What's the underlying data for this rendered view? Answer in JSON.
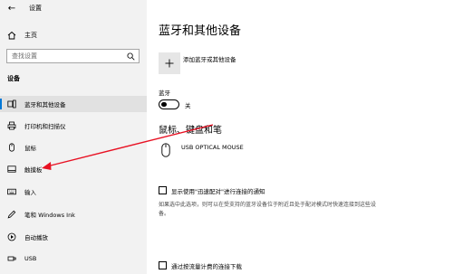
{
  "window": {
    "title": "设置"
  },
  "sidebar": {
    "home_label": "主页",
    "search_placeholder": "查找设置",
    "section_title": "设备",
    "items": [
      {
        "label": "蓝牙和其他设备",
        "icon": "bluetooth-devices-icon",
        "active": true
      },
      {
        "label": "打印机和扫描仪",
        "icon": "printer-icon",
        "active": false
      },
      {
        "label": "鼠标",
        "icon": "mouse-icon",
        "active": false
      },
      {
        "label": "触摸板",
        "icon": "touchpad-icon",
        "active": false
      },
      {
        "label": "输入",
        "icon": "keyboard-icon",
        "active": false
      },
      {
        "label": "笔和 Windows Ink",
        "icon": "pen-icon",
        "active": false
      },
      {
        "label": "自动播放",
        "icon": "autoplay-icon",
        "active": false
      },
      {
        "label": "USB",
        "icon": "usb-icon",
        "active": false
      }
    ]
  },
  "main": {
    "title": "蓝牙和其他设备",
    "add_device_label": "添加蓝牙或其他设备",
    "bluetooth_label": "蓝牙",
    "bluetooth_state": "关",
    "section_mouse": "鼠标、键盘和笔",
    "device_name": "USB OPTICAL MOUSE",
    "swift_pair_label": "显示使用\"迅速配对\"进行连接的通知",
    "swift_pair_desc": "如果选中此选项，则可以在受支持的蓝牙设备位于附近且处于配对模式时快速连接到这些设备。",
    "metered_label": "通过按流量计费的连接下载"
  },
  "colors": {
    "accent": "#0078d7",
    "sidebar_bg": "#f2f2f2",
    "annotation_arrow": "#e81123"
  }
}
